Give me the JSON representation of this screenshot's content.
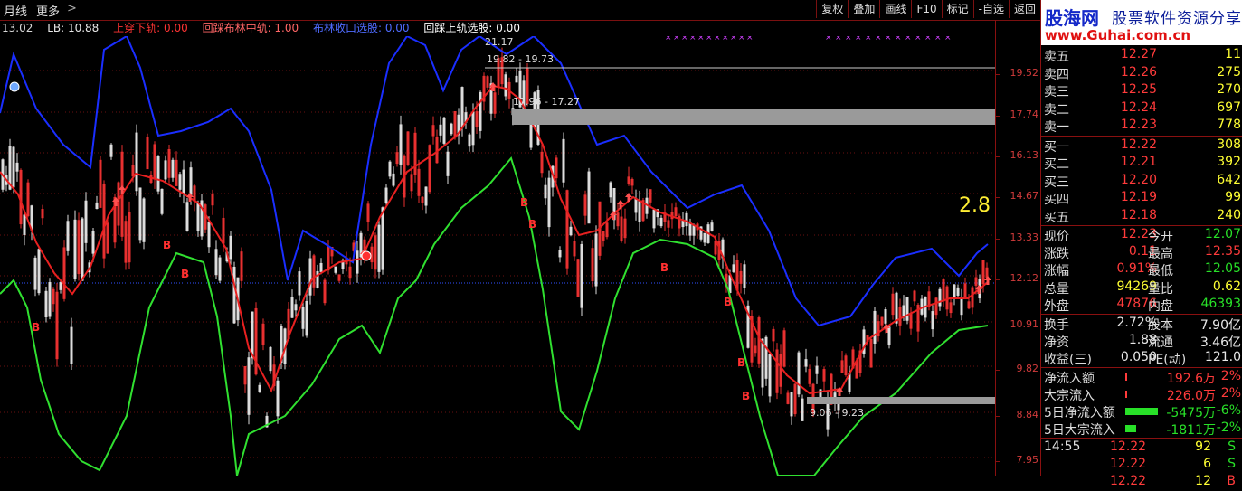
{
  "topbar": {
    "period": "月线",
    "more": "更多",
    "more_arrow": ">",
    "buttons": [
      "复权",
      "叠加",
      "画线",
      "F10",
      "标记",
      "-自选",
      "返回"
    ],
    "close": "×"
  },
  "indicators": [
    {
      "text": "13.02",
      "color": "#d8d8d8"
    },
    {
      "text": "LB: 10.88",
      "color": "#e8e8e8"
    },
    {
      "text": "上穿下轨: 0.00",
      "color": "#ff3333"
    },
    {
      "text": "回踩布林中轨: 1.00",
      "color": "#ff6666"
    },
    {
      "text": "布林收口选股: 0.00",
      "color": "#4f6bff"
    },
    {
      "text": "回踩上轨选股: 0.00",
      "color": "#ffffff"
    }
  ],
  "chart_labels": {
    "high_label": "21.17",
    "range1": "19.82 - 19.73",
    "range2": "17.96 - 17.27",
    "range3": "9.06 - 9.23",
    "big_value": "2.8",
    "b_marker": "B",
    "s_marker": "S"
  },
  "axis": {
    "labels": [
      "19.52",
      "17.74",
      "16.13",
      "14.67",
      "13.33",
      "12.12",
      "10.91",
      "9.82",
      "8.84",
      "7.95"
    ],
    "color": "#d23b3b"
  },
  "logo": {
    "title": "股海网",
    "slogan": "股票软件资源分享",
    "url": "www.Guhai.com.cn"
  },
  "order_book": {
    "asks": [
      {
        "label": "卖五",
        "price": "12.27",
        "vol": "11"
      },
      {
        "label": "卖四",
        "price": "12.26",
        "vol": "275"
      },
      {
        "label": "卖三",
        "price": "12.25",
        "vol": "270"
      },
      {
        "label": "卖二",
        "price": "12.24",
        "vol": "697"
      },
      {
        "label": "卖一",
        "price": "12.23",
        "vol": "778"
      }
    ],
    "bids": [
      {
        "label": "买一",
        "price": "12.22",
        "vol": "308"
      },
      {
        "label": "买二",
        "price": "12.21",
        "vol": "392"
      },
      {
        "label": "买三",
        "price": "12.20",
        "vol": "642"
      },
      {
        "label": "买四",
        "price": "12.19",
        "vol": "99"
      },
      {
        "label": "买五",
        "price": "12.18",
        "vol": "240"
      }
    ]
  },
  "quote": [
    {
      "l1": "现价",
      "v1": "12.23",
      "c1": "red",
      "l2": "今开",
      "v2": "12.07",
      "c2": "green"
    },
    {
      "l1": "涨跌",
      "v1": "0.11",
      "c1": "red",
      "l2": "最高",
      "v2": "12.35",
      "c2": "red"
    },
    {
      "l1": "涨幅",
      "v1": "0.91%",
      "c1": "red",
      "l2": "最低",
      "v2": "12.05",
      "c2": "green"
    },
    {
      "l1": "总量",
      "v1": "94269",
      "c1": "yellow",
      "l2": "量比",
      "v2": "0.62",
      "c2": "yellow"
    },
    {
      "l1": "外盘",
      "v1": "47876",
      "c1": "red",
      "l2": "内盘",
      "v2": "46393",
      "c2": "green"
    }
  ],
  "fundamentals": [
    {
      "l1": "换手",
      "v1": "2.72%",
      "c1": "white",
      "l2": "股本",
      "v2": "7.90亿",
      "c2": "white"
    },
    {
      "l1": "净资",
      "v1": "1.88",
      "c1": "white",
      "l2": "流通",
      "v2": "3.46亿",
      "c2": "white"
    },
    {
      "l1": "收益(三)",
      "v1": "0.050",
      "c1": "white",
      "l2": "PE(动)",
      "v2": "121.0",
      "c2": "white"
    }
  ],
  "flows": [
    {
      "label": "净流入额",
      "value": "192.6万",
      "pct": "2%",
      "bar": 0.02,
      "color": "red"
    },
    {
      "label": "大宗流入",
      "value": "226.0万",
      "pct": "2%",
      "bar": 0.02,
      "color": "red"
    },
    {
      "label": "5日净流入额",
      "value": "-5475万",
      "pct": "-6%",
      "bar": 0.9,
      "color": "green"
    },
    {
      "label": "5日大宗流入",
      "value": "-1811万",
      "pct": "-2%",
      "bar": 0.3,
      "color": "green"
    }
  ],
  "ticks": [
    {
      "time": "14:55",
      "price": "12.22",
      "vol": "92",
      "side": "S"
    },
    {
      "time": "",
      "price": "12.22",
      "vol": "6",
      "side": "S"
    },
    {
      "time": "",
      "price": "12.22",
      "vol": "12",
      "side": "B"
    }
  ]
}
